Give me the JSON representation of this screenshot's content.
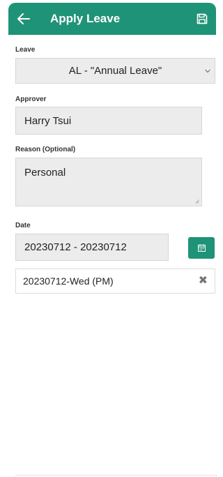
{
  "header": {
    "title": "Apply Leave",
    "back_icon": "arrow-left-icon",
    "save_icon": "floppy-disk-icon",
    "color": "#1f9377"
  },
  "form": {
    "leave": {
      "label": "Leave",
      "value": "AL - \"Annual Leave\""
    },
    "approver": {
      "label": "Approver",
      "value": "Harry Tsui"
    },
    "reason": {
      "label": "Reason (Optional)",
      "value": "Personal"
    },
    "date": {
      "label": "Date",
      "value": "20230712 - 20230712",
      "calendar_icon": "calendar-icon"
    },
    "days": [
      {
        "label": "20230712-Wed (PM)",
        "remove_icon": "close-icon"
      }
    ]
  }
}
